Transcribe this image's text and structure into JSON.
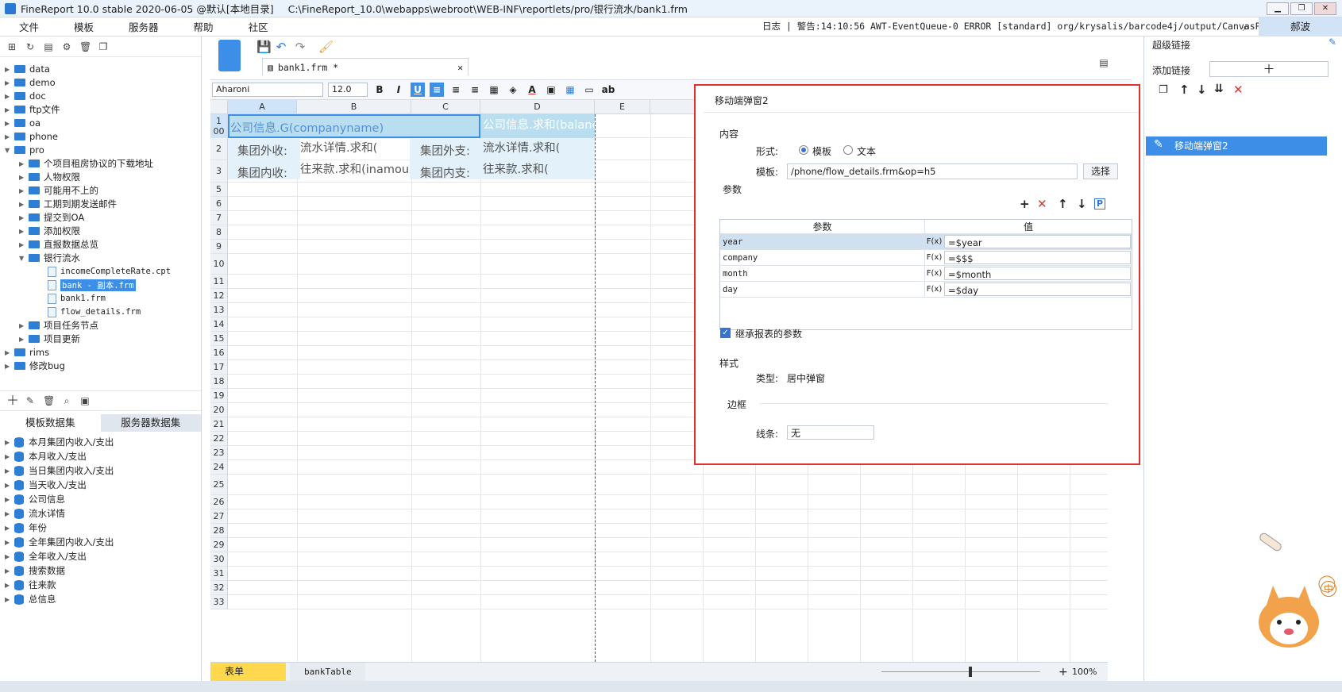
{
  "window": {
    "title": "FineReport 10.0 stable 2020-06-05 @默认[本地目录]",
    "path": "C:\\FineReport_10.0\\webapps\\webroot\\WEB-INF\\reportlets/pro/银行流水/bank1.frm"
  },
  "menu": [
    "文件",
    "模板",
    "服务器",
    "帮助",
    "社区"
  ],
  "log": "日志 | 警告:14:10:56 AWT-EventQueue-0 ERROR [standard] org/krysalis/barcode4j/output/CanvasProvider",
  "user": "郝波",
  "tree": {
    "top": [
      "data",
      "demo",
      "doc",
      "ftp文件",
      "oa",
      "phone"
    ],
    "pro": "pro",
    "pro_children": [
      "个项目租房协议的下载地址",
      "人物权限",
      "可能用不上的",
      "工期到期发送邮件",
      "提交到OA",
      "添加权限",
      "直报数据总览",
      "银行流水"
    ],
    "bank_files": [
      "incomeCompleteRate.cpt",
      "bank - 副本.frm",
      "bank1.frm",
      "flow_details.frm"
    ],
    "after": [
      "项目任务节点",
      "项目更新"
    ],
    "bottom": [
      "rims",
      "修改bug"
    ]
  },
  "datasets": {
    "tabs": [
      "模板数据集",
      "服务器数据集"
    ],
    "items": [
      "本月集团内收入/支出",
      "本月收入/支出",
      "当日集团内收入/支出",
      "当天收入/支出",
      "公司信息",
      "流水详情",
      "年份",
      "全年集团内收入/支出",
      "全年收入/支出",
      "搜索数据",
      "往来款",
      "总信息"
    ]
  },
  "editor": {
    "tab": "bank1.frm *",
    "font": "Aharoni",
    "size": "12.0",
    "columns": [
      "A",
      "B",
      "C",
      "D",
      "E"
    ],
    "rows": [
      "1 00",
      "2",
      "3",
      "5",
      "6",
      "7",
      "8",
      "9",
      "10",
      "11",
      "12",
      "13",
      "14",
      "15",
      "16",
      "17",
      "18",
      "19",
      "20",
      "21",
      "22",
      "23",
      "24",
      "25",
      "26",
      "27",
      "28",
      "29",
      "30",
      "31",
      "32",
      "33"
    ],
    "cells": {
      "a1": "公司信息.G(companyname)",
      "d1": "公司信息.求和(balance",
      "a2": "集团外收:",
      "b2": "流水详情.求和(",
      "c2": "集团外支:",
      "d2": "流水详情.求和(",
      "a3": "集团内收:",
      "b3": "往来款.求和(inamount",
      "c3": "集团内支:",
      "d3": "往来款.求和("
    },
    "sheets": [
      "表单",
      "bankTable"
    ],
    "zoom": "100%"
  },
  "dialog": {
    "title": "移动端弹窗2",
    "content_label": "内容",
    "form_label": "形式:",
    "radio_template": "模板",
    "radio_text": "文本",
    "template_label": "模板:",
    "template_value": "/phone/flow_details.frm&op=h5",
    "choose": "选择",
    "params_label": "参数",
    "col_param": "参数",
    "col_value": "值",
    "params": [
      {
        "name": "year",
        "value": "=$year"
      },
      {
        "name": "company",
        "value": "=$$$"
      },
      {
        "name": "month",
        "value": "=$month"
      },
      {
        "name": "day",
        "value": "=$day"
      }
    ],
    "inherit": "继承报表的参数",
    "style_label": "样式",
    "type_label": "类型:",
    "type_value": "居中弹窗",
    "border_label": "边框",
    "line_label": "线条:",
    "line_value": "无"
  },
  "right": {
    "title": "超级链接",
    "add_link": "添加链接",
    "item": "移动端弹窗2"
  },
  "ime": "中"
}
